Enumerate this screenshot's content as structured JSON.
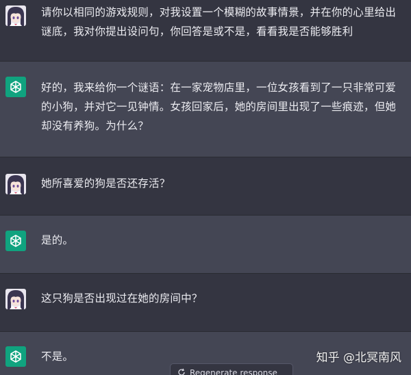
{
  "colors": {
    "user_bg": "#343541",
    "assistant_bg": "#444654",
    "assistant_avatar": "#10a37f",
    "text": "#ececf1"
  },
  "messages": [
    {
      "role": "user",
      "avatar": "anime-girl-avatar",
      "text": "请你以相同的游戏规则，对我设置一个模糊的故事情景，并在你的心里给出谜底，我对你提出设问句，你回答是或不是，看看我是否能够胜利"
    },
    {
      "role": "assistant",
      "avatar": "openai-logo-icon",
      "text": "好的，我来给你一个谜语：在一家宠物店里，一位女孩看到了一只非常可爱的小狗，并对它一见钟情。女孩回家后，她的房间里出现了一些痕迹，但她却没有养狗。为什么？"
    },
    {
      "role": "user",
      "avatar": "anime-girl-avatar",
      "text": "她所喜爱的狗是否还存活？"
    },
    {
      "role": "assistant",
      "avatar": "openai-logo-icon",
      "text": "是的。"
    },
    {
      "role": "user",
      "avatar": "anime-girl-avatar",
      "text": "这只狗是否出现过在她的房间中？"
    },
    {
      "role": "assistant",
      "avatar": "openai-logo-icon",
      "text": "不是。"
    }
  ],
  "regenerate_label": "Regenerate response",
  "watermark": "知乎 @北冥南风"
}
